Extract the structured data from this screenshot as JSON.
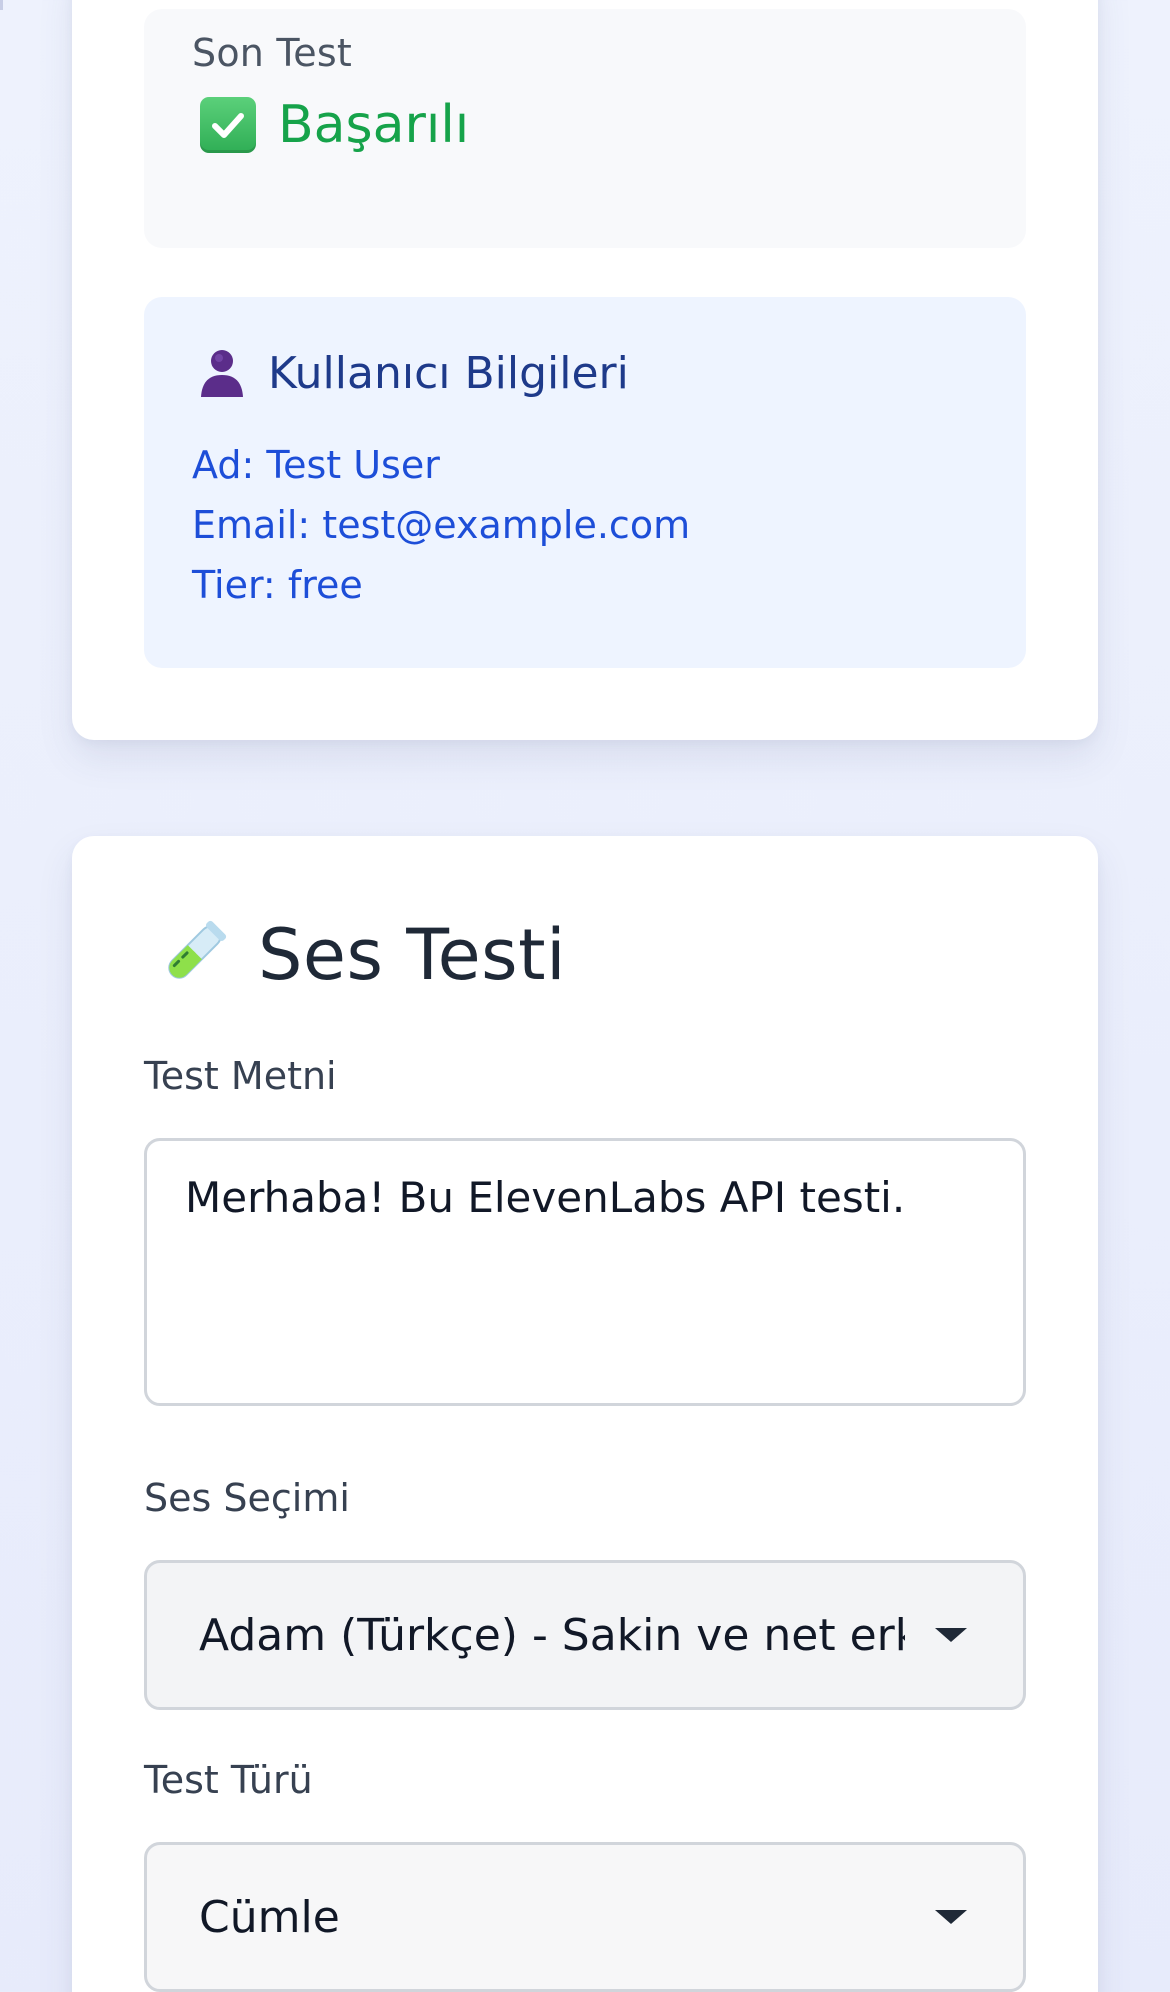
{
  "account": {
    "last_test_label": "Son Test",
    "last_test_status": "Başarılı",
    "status_icon": "check-mark-button-icon",
    "status_color": "#16a34a"
  },
  "user_info": {
    "icon": "bust-in-silhouette-icon",
    "title": "Kullanıcı Bilgileri",
    "name_line": "Ad: Test User",
    "email_line": "Email: test@example.com",
    "tier_line": "Tier: free"
  },
  "voice_test": {
    "icon": "test-tube-icon",
    "title": "Ses Testi",
    "text_label": "Test Metni",
    "text_value": "Merhaba! Bu ElevenLabs API testi.",
    "voice_label": "Ses Seçimi",
    "voice_selected": "Adam (Türkçe) - Sakin ve net erkek sesi",
    "type_label": "Test Türü",
    "type_selected": "Cümle"
  },
  "colors": {
    "page_background": "#e9edfb",
    "card_background": "#ffffff",
    "status_box": "#f8f9fb",
    "user_box": "#eef4ff",
    "user_title": "#1e3a8a",
    "user_text": "#1d4ed8"
  }
}
